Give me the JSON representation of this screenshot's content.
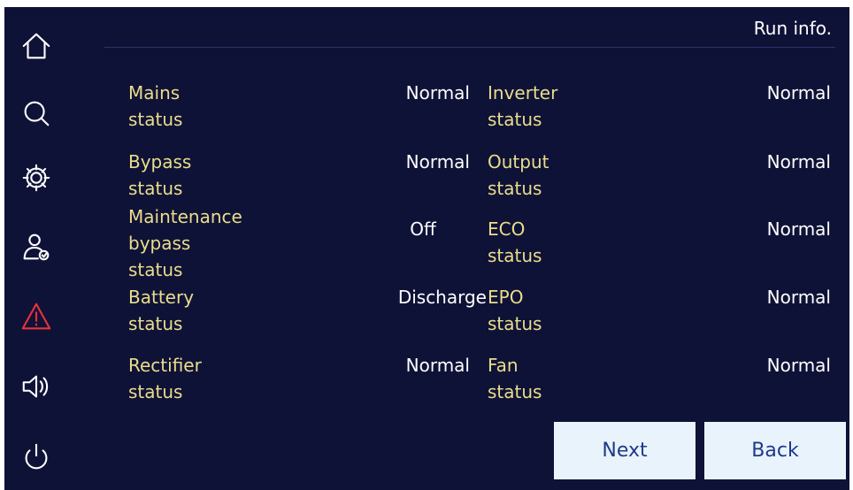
{
  "header": {
    "title": "Run info."
  },
  "sidebar": {
    "items": [
      {
        "icon": "home-icon"
      },
      {
        "icon": "search-icon"
      },
      {
        "icon": "gear-icon"
      },
      {
        "icon": "user-check-icon"
      },
      {
        "icon": "alarm-warning-icon",
        "color": "#e9323b"
      },
      {
        "icon": "speaker-icon"
      },
      {
        "icon": "power-icon"
      }
    ]
  },
  "status": {
    "left": [
      {
        "label": "Mains status",
        "value": "Normal"
      },
      {
        "label": "Bypass status",
        "value": "Normal"
      },
      {
        "label": "Maintenance bypass status",
        "label_line1": "Maintenance bypass",
        "label_line2": "status",
        "value": "Off"
      },
      {
        "label": "Battery status",
        "value": "Discharge"
      },
      {
        "label": "Rectifier status",
        "value": "Normal"
      }
    ],
    "right": [
      {
        "label": "Inverter status",
        "value": "Normal"
      },
      {
        "label": "Output status",
        "value": "Normal"
      },
      {
        "label": "ECO status",
        "value": "Normal"
      },
      {
        "label": "EPO status",
        "value": "Normal"
      },
      {
        "label": "Fan status",
        "value": "Normal"
      }
    ]
  },
  "buttons": {
    "next_label": "Next",
    "back_label": "Back"
  },
  "colors": {
    "background": "#0f1237",
    "label": "#e9dd8c",
    "value": "#ffffff",
    "button_bg": "#e9f3fb",
    "button_text": "#1e3a8c"
  }
}
